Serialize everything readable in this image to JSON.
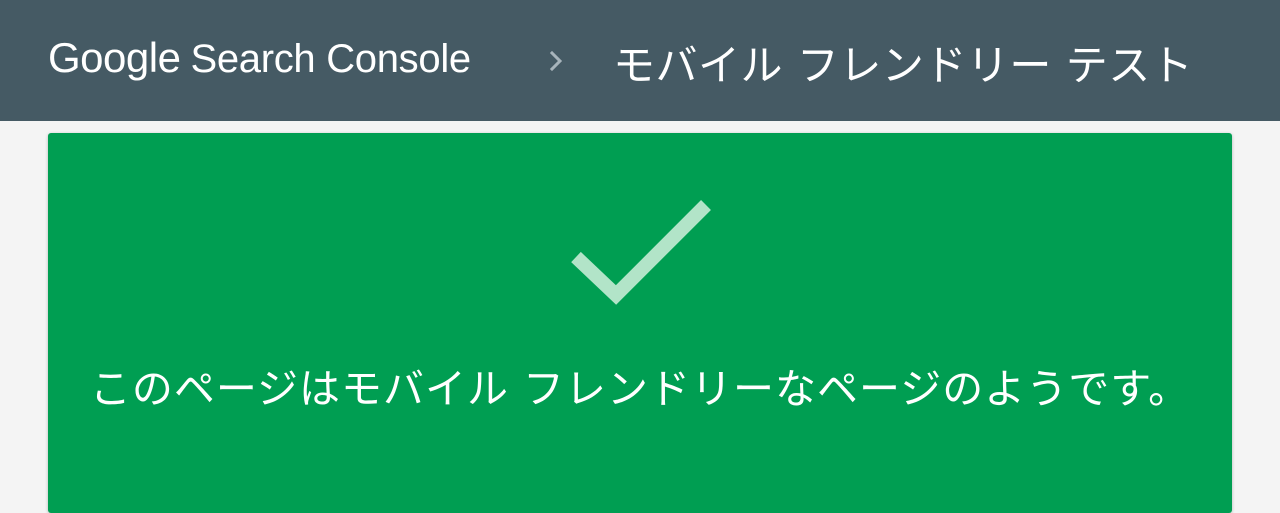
{
  "header": {
    "brand_google": "Google",
    "brand_product": "Search Console",
    "breadcrumb_separator_icon": "chevron-right-icon",
    "page_title": "モバイル フレンドリー テスト",
    "background_color": "#455a64"
  },
  "result": {
    "status_icon": "checkmark-icon",
    "message": "このページはモバイル フレンドリーなページのようです。",
    "background_color": "#009e52",
    "icon_color": "#b2e4c8"
  }
}
